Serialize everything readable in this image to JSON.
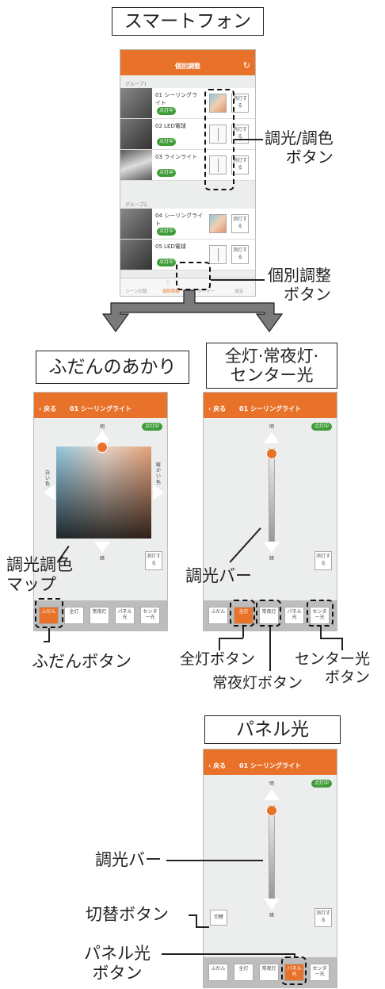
{
  "top": {
    "title": "スマートフォン",
    "screen": {
      "nav_title": "個別調整",
      "groups": [
        {
          "label": "グループ1",
          "rows": [
            {
              "name": "01 シーリングライト",
              "status": "点灯中",
              "btn": "消灯する"
            },
            {
              "name": "02 LED電球",
              "status": "点灯中",
              "btn": "消灯する"
            },
            {
              "name": "03 ラインライト",
              "status": "点灯中",
              "btn": "消灯する"
            }
          ]
        },
        {
          "label": "グループ2",
          "rows": [
            {
              "name": "04 シーリングライト",
              "status": "点灯中",
              "btn": "消灯する"
            },
            {
              "name": "05 LED電球",
              "status": "点灯中",
              "btn": "消灯する"
            }
          ]
        }
      ],
      "tabs": [
        "シーン切替",
        "個別調整",
        "タイマー",
        "設定"
      ]
    },
    "callout_dimming": [
      "調光/調色",
      "ボタン"
    ],
    "callout_individual": [
      "個別調整",
      "ボタン"
    ]
  },
  "left_panel": {
    "title": "ふだんのあかり",
    "back": "戻る",
    "nav_title": "01 シーリングライト",
    "status": "点灯中",
    "bright": "明",
    "dark": "暗",
    "white": "白い色",
    "warm": "暖かい色",
    "off_btn": "消灯する",
    "modes": [
      "ふだん",
      "全灯",
      "常夜灯",
      "パネル光",
      "センター光"
    ],
    "callout_map": [
      "調光調色",
      "マップ"
    ],
    "callout_btn": "ふだんボタン"
  },
  "right_panel": {
    "title": [
      "全灯·常夜灯·",
      "センター光"
    ],
    "back": "戻る",
    "nav_title": "01 シーリングライト",
    "status": "点灯中",
    "bright": "明",
    "dark": "暗",
    "off_btn": "消灯する",
    "modes": [
      "ふだん",
      "全灯",
      "常夜灯",
      "パネル光",
      "センター光"
    ],
    "callout_bar": "調光バー",
    "callout_all": "全灯ボタン",
    "callout_night": "常夜灯ボタン",
    "callout_center": [
      "センター光",
      "ボタン"
    ]
  },
  "bottom_panel": {
    "title": "パネル光",
    "back": "戻る",
    "nav_title": "01 シーリングライト",
    "status": "点灯中",
    "bright": "明",
    "dark": "暗",
    "switch_btn": "切替",
    "off_btn": "消灯する",
    "modes": [
      "ふだん",
      "全灯",
      "常夜灯",
      "パネル光",
      "センター光"
    ],
    "callout_bar": "調光バー",
    "callout_switch": "切替ボタン",
    "callout_panel": [
      "パネル光",
      "ボタン"
    ]
  },
  "colors": {
    "accent": "#e8722a",
    "status_green": "#3f9c38"
  }
}
